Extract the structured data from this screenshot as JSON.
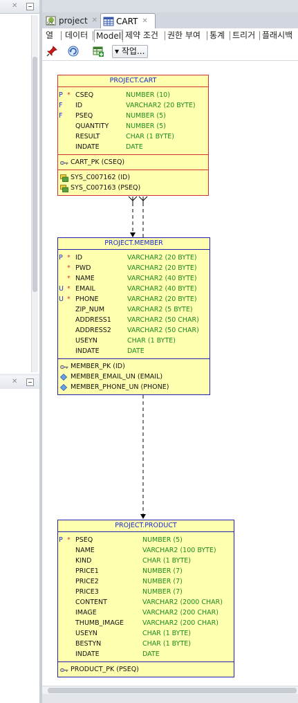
{
  "tabs": [
    {
      "label": "project",
      "icon": "sql-worksheet-icon"
    },
    {
      "label": "CART",
      "icon": "table-grid-icon"
    }
  ],
  "subtabs": [
    "열",
    "데이터",
    "Model",
    "제약 조건",
    "권한 부여",
    "통계",
    "트리거",
    "플래시백"
  ],
  "active_subtab": "Model",
  "toolbar": {
    "icons": [
      "pin-icon",
      "refresh-icon",
      "add-table-icon"
    ],
    "actions_label": "작업..."
  },
  "entities": {
    "cart": {
      "title": "PROJECT.CART",
      "border": "#d03030",
      "columns": [
        {
          "key": "P",
          "mand": "*",
          "name": "CSEQ",
          "type": "NUMBER (10)"
        },
        {
          "key": "F",
          "mand": "",
          "name": "ID",
          "type": "VARCHAR2 (20 BYTE)"
        },
        {
          "key": "F",
          "mand": "",
          "name": "PSEQ",
          "type": "NUMBER (5)"
        },
        {
          "key": "",
          "mand": "",
          "name": "QUANTITY",
          "type": "NUMBER (5)"
        },
        {
          "key": "",
          "mand": "",
          "name": "RESULT",
          "type": "CHAR (1 BYTE)"
        },
        {
          "key": "",
          "mand": "",
          "name": "INDATE",
          "type": "DATE"
        }
      ],
      "keys": [
        {
          "icon": "key-icon",
          "label": "CART_PK (CSEQ)"
        }
      ],
      "foreign": [
        {
          "icon": "foreign-key-icon",
          "label": "SYS_C007162 (ID)"
        },
        {
          "icon": "foreign-key-icon",
          "label": "SYS_C007163 (PSEQ)"
        }
      ]
    },
    "member": {
      "title": "PROJECT.MEMBER",
      "border": "#2020b0",
      "columns": [
        {
          "key": "P",
          "mand": "*",
          "name": "ID",
          "type": "VARCHAR2 (20 BYTE)"
        },
        {
          "key": "",
          "mand": "*",
          "name": "PWD",
          "type": "VARCHAR2 (20 BYTE)"
        },
        {
          "key": "",
          "mand": "*",
          "name": "NAME",
          "type": "VARCHAR2 (40 BYTE)"
        },
        {
          "key": "U",
          "mand": "*",
          "name": "EMAIL",
          "type": "VARCHAR2 (40 BYTE)"
        },
        {
          "key": "U",
          "mand": "*",
          "name": "PHONE",
          "type": "VARCHAR2 (20 BYTE)"
        },
        {
          "key": "",
          "mand": "",
          "name": "ZIP_NUM",
          "type": "VARCHAR2 (5 BYTE)"
        },
        {
          "key": "",
          "mand": "",
          "name": "ADDRESS1",
          "type": "VARCHAR2 (50 CHAR)"
        },
        {
          "key": "",
          "mand": "",
          "name": "ADDRESS2",
          "type": "VARCHAR2 (50 CHAR)"
        },
        {
          "key": "",
          "mand": "",
          "name": "USEYN",
          "type": "CHAR (1 BYTE)"
        },
        {
          "key": "",
          "mand": "",
          "name": "INDATE",
          "type": "DATE"
        }
      ],
      "keys": [
        {
          "icon": "key-icon",
          "label": "MEMBER_PK (ID)"
        },
        {
          "icon": "unique-key-icon",
          "label": "MEMBER_EMAIL_UN (EMAIL)"
        },
        {
          "icon": "unique-key-icon",
          "label": "MEMBER_PHONE_UN (PHONE)"
        }
      ]
    },
    "product": {
      "title": "PROJECT.PRODUCT",
      "border": "#2020b0",
      "columns": [
        {
          "key": "P",
          "mand": "*",
          "name": "PSEQ",
          "type": "NUMBER (5)"
        },
        {
          "key": "",
          "mand": "",
          "name": "NAME",
          "type": "VARCHAR2 (100 BYTE)"
        },
        {
          "key": "",
          "mand": "",
          "name": "KIND",
          "type": "CHAR (1 BYTE)"
        },
        {
          "key": "",
          "mand": "",
          "name": "PRICE1",
          "type": "NUMBER (7)"
        },
        {
          "key": "",
          "mand": "",
          "name": "PRICE2",
          "type": "NUMBER (7)"
        },
        {
          "key": "",
          "mand": "",
          "name": "PRICE3",
          "type": "NUMBER (7)"
        },
        {
          "key": "",
          "mand": "",
          "name": "CONTENT",
          "type": "VARCHAR2 (2000 CHAR)"
        },
        {
          "key": "",
          "mand": "",
          "name": "IMAGE",
          "type": "VARCHAR2 (200 CHAR)"
        },
        {
          "key": "",
          "mand": "",
          "name": "THUMB_IMAGE",
          "type": "VARCHAR2 (200 CHAR)"
        },
        {
          "key": "",
          "mand": "",
          "name": "USEYN",
          "type": "CHAR (1 BYTE)"
        },
        {
          "key": "",
          "mand": "",
          "name": "BESTYN",
          "type": "CHAR (1 BYTE)"
        },
        {
          "key": "",
          "mand": "",
          "name": "INDATE",
          "type": "DATE"
        }
      ],
      "keys": [
        {
          "icon": "key-icon",
          "label": "PRODUCT_PK (PSEQ)"
        }
      ]
    }
  }
}
